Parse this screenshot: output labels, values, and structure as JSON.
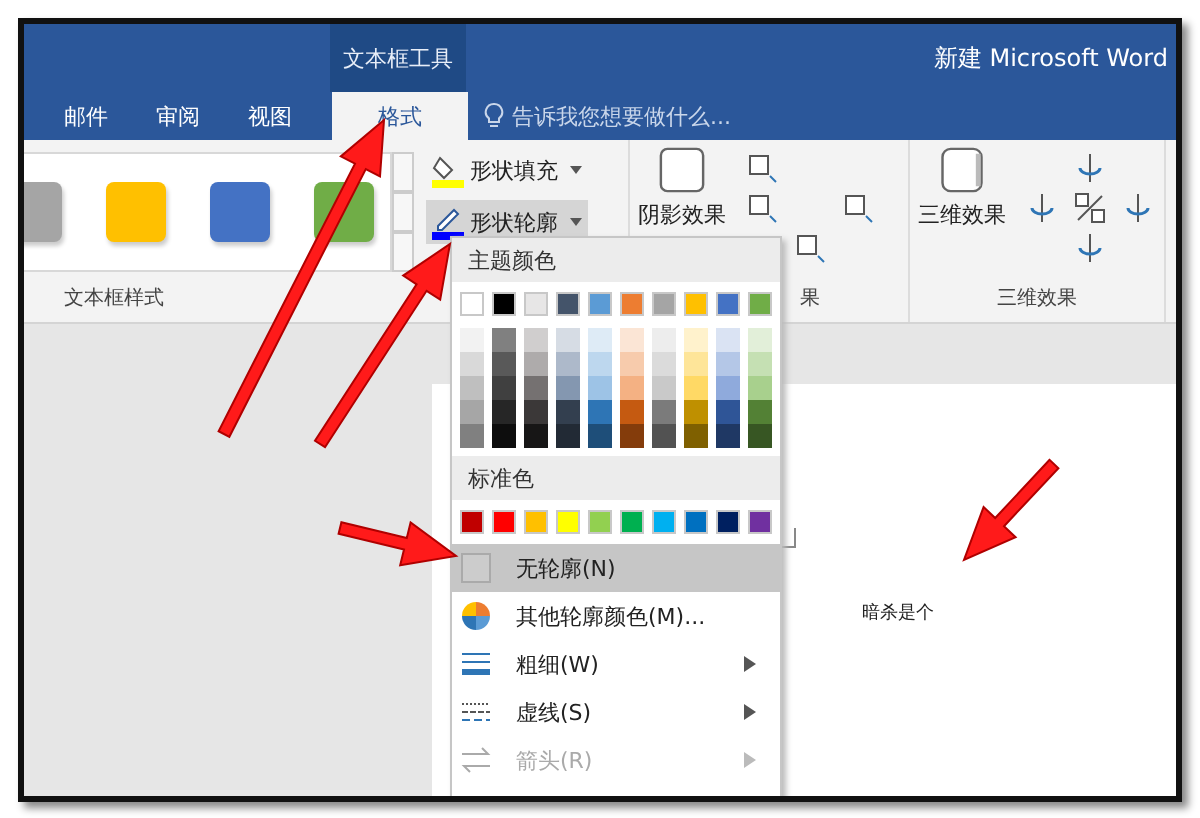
{
  "window": {
    "context_tab_group": "文本框工具",
    "title": "新建 Microsoft Word"
  },
  "tabs": [
    {
      "label": "邮件",
      "selected": false
    },
    {
      "label": "审阅",
      "selected": false
    },
    {
      "label": "视图",
      "selected": false
    },
    {
      "label": "格式",
      "selected": true
    }
  ],
  "tell_me": {
    "placeholder": "告诉我您想要做什么..."
  },
  "ribbon": {
    "style_gallery": [
      {
        "color": "#a5a5a5"
      },
      {
        "color": "#ffc000"
      },
      {
        "color": "#4472c4"
      },
      {
        "color": "#70ad47"
      }
    ],
    "style_group_label": "文本框样式",
    "fill_button": "形状填充",
    "outline_button": "形状轮廓",
    "shadow_button": "阴影效果",
    "shadow_group_label": "果",
    "three_d_button": "三维效果",
    "three_d_group_label": "三维效果"
  },
  "outline_menu": {
    "theme_header": "主题颜色",
    "theme_colors": [
      {
        "color": "#ffffff"
      },
      {
        "color": "#000000"
      },
      {
        "color": "#e7e6e6"
      },
      {
        "color": "#44546a"
      },
      {
        "color": "#5b9bd5"
      },
      {
        "color": "#ed7d31"
      },
      {
        "color": "#a5a5a5"
      },
      {
        "color": "#ffc000"
      },
      {
        "color": "#4472c4"
      },
      {
        "color": "#70ad47"
      }
    ],
    "shade_columns": [
      [
        {
          "color": "#f2f2f2"
        },
        {
          "color": "#d9d9d9"
        },
        {
          "color": "#bfbfbf"
        },
        {
          "color": "#a6a6a6"
        },
        {
          "color": "#808080"
        }
      ],
      [
        {
          "color": "#808080"
        },
        {
          "color": "#595959"
        },
        {
          "color": "#404040"
        },
        {
          "color": "#262626"
        },
        {
          "color": "#0d0d0d"
        }
      ],
      [
        {
          "color": "#d0cece"
        },
        {
          "color": "#aeabab"
        },
        {
          "color": "#757171"
        },
        {
          "color": "#3b3838"
        },
        {
          "color": "#171616"
        }
      ],
      [
        {
          "color": "#d6dce4"
        },
        {
          "color": "#adb9ca"
        },
        {
          "color": "#8497b0"
        },
        {
          "color": "#333f4f"
        },
        {
          "color": "#222a35"
        }
      ],
      [
        {
          "color": "#deebf6"
        },
        {
          "color": "#bdd7ee"
        },
        {
          "color": "#9dc3e6"
        },
        {
          "color": "#2e75b5"
        },
        {
          "color": "#1e4e79"
        }
      ],
      [
        {
          "color": "#fbe5d5"
        },
        {
          "color": "#f7cbac"
        },
        {
          "color": "#f4b183"
        },
        {
          "color": "#c55a11"
        },
        {
          "color": "#843c0b"
        }
      ],
      [
        {
          "color": "#ededed"
        },
        {
          "color": "#dbdbdb"
        },
        {
          "color": "#c9c9c9"
        },
        {
          "color": "#7b7b7b"
        },
        {
          "color": "#525252"
        }
      ],
      [
        {
          "color": "#fff2cc"
        },
        {
          "color": "#fee599"
        },
        {
          "color": "#ffd965"
        },
        {
          "color": "#bf9000"
        },
        {
          "color": "#7f6000"
        }
      ],
      [
        {
          "color": "#dae3f3"
        },
        {
          "color": "#b4c7e7"
        },
        {
          "color": "#8faadc"
        },
        {
          "color": "#2f5597"
        },
        {
          "color": "#1f3864"
        }
      ],
      [
        {
          "color": "#e2efd9"
        },
        {
          "color": "#c5e0b3"
        },
        {
          "color": "#a8d08d"
        },
        {
          "color": "#538135"
        },
        {
          "color": "#375623"
        }
      ]
    ],
    "standard_header": "标准色",
    "standard_colors": [
      {
        "color": "#c00000"
      },
      {
        "color": "#ff0000"
      },
      {
        "color": "#ffc000"
      },
      {
        "color": "#ffff00"
      },
      {
        "color": "#92d050"
      },
      {
        "color": "#00b050"
      },
      {
        "color": "#00b0f0"
      },
      {
        "color": "#0070c0"
      },
      {
        "color": "#002060"
      },
      {
        "color": "#7030a0"
      }
    ],
    "items": [
      {
        "kind": "none",
        "label": "无轮廓(N)",
        "selected": true,
        "disabled": false,
        "submenu": false
      },
      {
        "kind": "more",
        "label": "其他轮廓颜色(M)...",
        "selected": false,
        "disabled": false,
        "submenu": false
      },
      {
        "kind": "weight",
        "label": "粗细(W)",
        "selected": false,
        "disabled": false,
        "submenu": true
      },
      {
        "kind": "dash",
        "label": "虚线(S)",
        "selected": false,
        "disabled": false,
        "submenu": true
      },
      {
        "kind": "arrows",
        "label": "箭头(R)",
        "selected": false,
        "disabled": true,
        "submenu": true
      }
    ]
  },
  "document": {
    "text": "暗杀是个"
  }
}
